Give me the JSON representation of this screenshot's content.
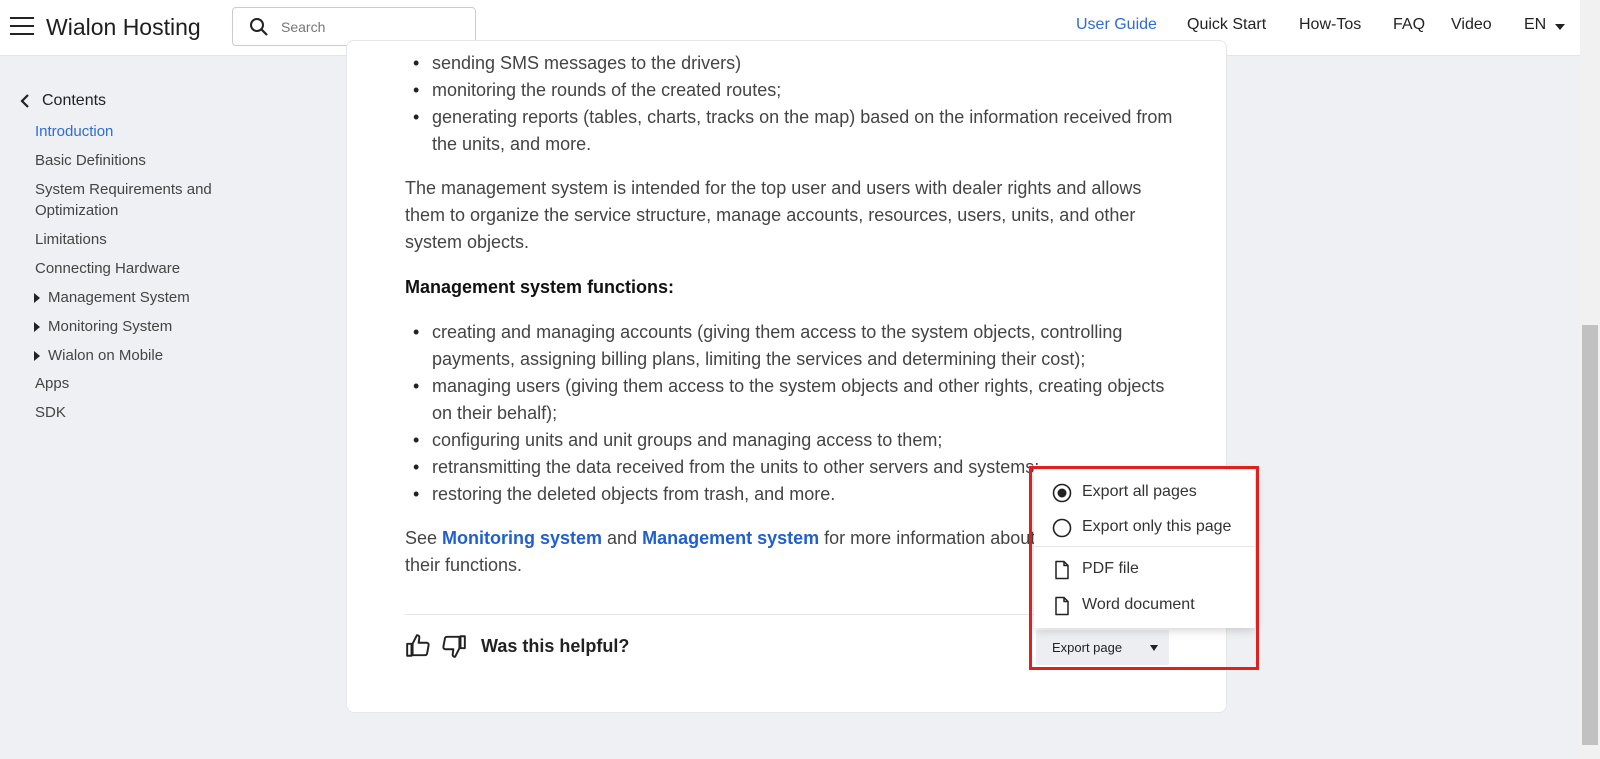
{
  "header": {
    "brand": "Wialon Hosting",
    "search_placeholder": "Search",
    "nav": [
      "User Guide",
      "Quick Start",
      "How-Tos",
      "FAQ",
      "Video",
      "EN"
    ]
  },
  "sidebar": {
    "contents_label": "Contents",
    "items": [
      {
        "label": "Introduction"
      },
      {
        "label": "Basic Definitions"
      },
      {
        "label": "System Requirements and Optimization"
      },
      {
        "label": "Limitations"
      },
      {
        "label": "Connecting Hardware"
      },
      {
        "label": "Management System"
      },
      {
        "label": "Monitoring System"
      },
      {
        "label": "Wialon on Mobile"
      },
      {
        "label": "Apps"
      },
      {
        "label": "SDK"
      }
    ]
  },
  "content": {
    "bullets_top": [
      "sending SMS messages to the drivers)",
      "monitoring the rounds of the created routes;",
      "generating reports (tables, charts, tracks on the map) based on the information received from the units, and more."
    ],
    "para1": "The management system is intended for the top user and users with dealer rights and allows them to organize the service structure, manage accounts, resources, users, units, and other system objects.",
    "heading": "Management system functions:",
    "bullets_mgmt": [
      "creating and managing accounts (giving them access to the system objects, controlling payments, assigning billing plans, limiting the services and determining their cost);",
      "managing users (giving them access to the system objects and other rights, creating objects on their behalf);",
      "configuring units and unit groups and managing access to them;",
      "retransmitting the data received from the units to other servers and systems;",
      "restoring the deleted objects from trash, and more."
    ],
    "see_prefix": "See ",
    "link_monitoring": "Monitoring system",
    "see_and": " and ",
    "link_management": "Management system",
    "see_suffix": " for more information about their functions."
  },
  "feedback": {
    "question": "Was this helpful?"
  },
  "export": {
    "button_label": "Export page",
    "menu": {
      "export_all": "Export all pages",
      "export_this": "Export only this page",
      "pdf": "PDF file",
      "word": "Word document"
    }
  }
}
